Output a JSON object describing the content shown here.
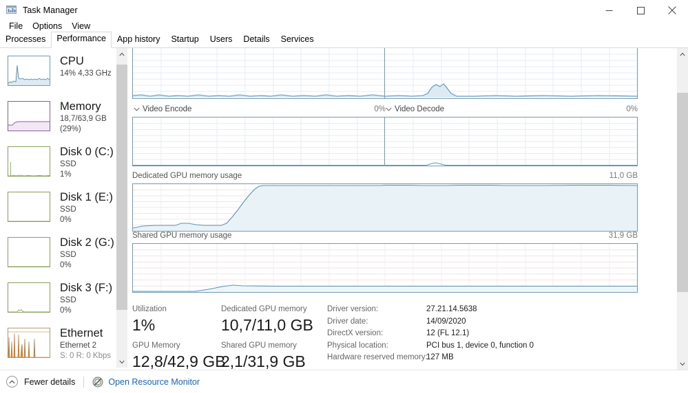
{
  "window": {
    "title": "Task Manager",
    "icon": "task-manager-icon",
    "minimize_label": "─",
    "maximize_label": "☐",
    "close_label": "×"
  },
  "menu": {
    "items": [
      {
        "label": "File"
      },
      {
        "label": "Options"
      },
      {
        "label": "View"
      }
    ]
  },
  "tabs": {
    "active": "Performance",
    "items": [
      {
        "label": "Processes"
      },
      {
        "label": "Performance"
      },
      {
        "label": "App history"
      },
      {
        "label": "Startup"
      },
      {
        "label": "Users"
      },
      {
        "label": "Details"
      },
      {
        "label": "Services"
      }
    ]
  },
  "sidebar": {
    "items": [
      {
        "name": "CPU",
        "line2": "14%  4,33 GHz",
        "line3": "",
        "line4": "",
        "accent": "#3b87b5",
        "fill": "#ddeaf2"
      },
      {
        "name": "Memory",
        "line2": "18,7/63,9 GB (29%)",
        "line3": "",
        "line4": "",
        "accent": "#8b5f9e",
        "fill": "#f0e6f3"
      },
      {
        "name": "Disk 0 (C:)",
        "line2": "SSD",
        "line3": "1%",
        "line4": "",
        "accent": "#7f9b4e",
        "fill": "#eef2e4"
      },
      {
        "name": "Disk 1 (E:)",
        "line2": "SSD",
        "line3": "0%",
        "line4": "",
        "accent": "#7f9b4e",
        "fill": "#eef2e4"
      },
      {
        "name": "Disk 2 (G:)",
        "line2": "SSD",
        "line3": "0%",
        "line4": "",
        "accent": "#7f9b4e",
        "fill": "#eef2e4"
      },
      {
        "name": "Disk 3 (F:)",
        "line2": "SSD",
        "line3": "0%",
        "line4": "",
        "accent": "#7f9b4e",
        "fill": "#eef2e4"
      },
      {
        "name": "Ethernet",
        "line2": "Ethernet 2",
        "line3": "S: 0 R: 0 Kbps",
        "line4": "",
        "accent": "#b5702a",
        "fill": "#f6e6d5"
      }
    ],
    "scrollbar": {
      "up_arrow": "chevron-up",
      "down_arrow": "chevron-down"
    }
  },
  "main": {
    "graphs": {
      "top_left": {
        "label": "",
        "value": ""
      },
      "top_right": {
        "label": "",
        "value": ""
      },
      "video_encode": {
        "label": "Video Encode",
        "value": "0%"
      },
      "video_decode": {
        "label": "Video Decode",
        "value": "0%"
      },
      "dedicated_memory": {
        "label": "Dedicated GPU memory usage",
        "value": "11,0 GB"
      },
      "shared_memory": {
        "label": "Shared GPU memory usage",
        "value": "31,9 GB"
      }
    },
    "stats": {
      "utilization": {
        "label": "Utilization",
        "value": "1%"
      },
      "dedicated_gpu_memory": {
        "label": "Dedicated GPU memory",
        "value": "10,7/11,0 GB"
      },
      "gpu_memory": {
        "label": "GPU Memory",
        "value": "12,8/42,9 GB"
      },
      "shared_gpu_memory": {
        "label": "Shared GPU memory",
        "value": "2,1/31,9 GB"
      },
      "details": [
        {
          "label": "Driver version:",
          "value": "27.21.14.5638"
        },
        {
          "label": "Driver date:",
          "value": "14/09/2020"
        },
        {
          "label": "DirectX version:",
          "value": "12 (FL 12.1)"
        },
        {
          "label": "Physical location:",
          "value": "PCI bus 1, device 0, function 0"
        },
        {
          "label": "Hardware reserved memory:",
          "value": "127 MB"
        }
      ]
    },
    "scrollbar": {
      "up_arrow": "chevron-up",
      "down_arrow": "chevron-down"
    }
  },
  "statusbar": {
    "fewer_details": "Fewer details",
    "open_resource_monitor": "Open Resource Monitor",
    "chevron": "chevron-up-icon",
    "resource_icon": "resource-monitor-icon"
  },
  "colors": {
    "graph_stroke": "#6e9bb5",
    "graph_fill": "#e8f1f6",
    "grid": "#e4eef4",
    "link": "#1566c0",
    "scroll_thumb": "#cdcdcd",
    "scroll_track": "#f0f0f0"
  }
}
